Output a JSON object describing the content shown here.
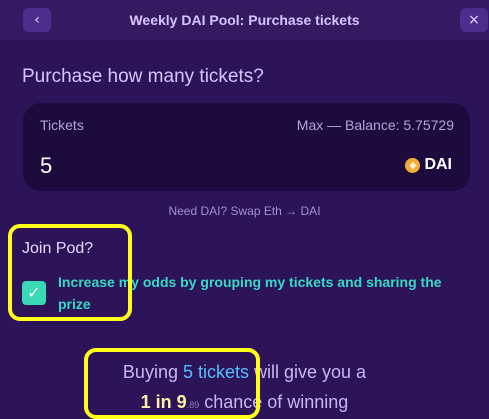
{
  "header": {
    "title": "Weekly DAI Pool: Purchase tickets",
    "back_icon": "‹",
    "close_icon": "×"
  },
  "purchase": {
    "heading": "Purchase how many tickets?",
    "tickets_label": "Tickets",
    "balance_text": "Max — Balance: 5.75729",
    "tickets_value": "5",
    "token_label": "DAI",
    "token_icon": "◈"
  },
  "swap_link": "Need DAI? Swap Eth → DAI",
  "join_pod": {
    "title": "Join Pod?",
    "checked": true,
    "check_icon": "✓",
    "description": "Increase my odds by grouping my tickets and sharing the prize"
  },
  "summary": {
    "prefix": "Buying ",
    "tickets": "5 tickets",
    "middle": " will give you a",
    "odds": "1 in 9",
    "odds_decimal": ".89",
    "suffix": " chance of winning"
  },
  "colors": {
    "background": "#2d1458",
    "accent_teal": "#38d9b4",
    "highlight": "#ffff1a"
  }
}
